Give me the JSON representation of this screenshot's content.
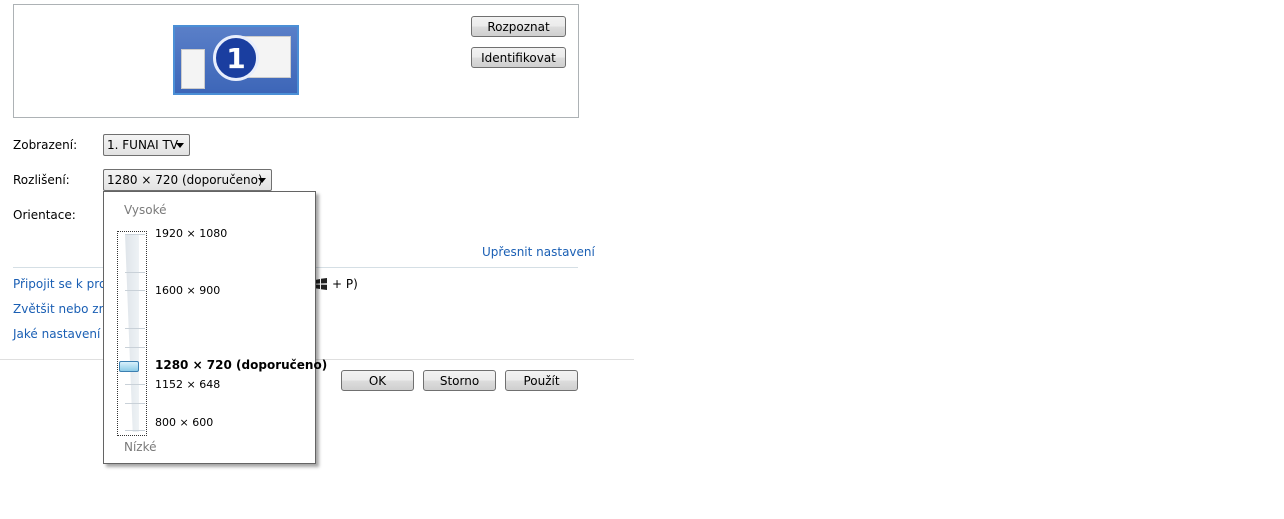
{
  "buttons": {
    "detect": "Rozpoznat",
    "identify": "Identifikovat",
    "ok": "OK",
    "cancel": "Storno",
    "apply": "Použít"
  },
  "preview": {
    "monitor_number": "1"
  },
  "fields": {
    "display_label": "Zobrazení:",
    "display_value": "1. FUNAI TV",
    "resolution_label": "Rozlišení:",
    "resolution_value": "1280 × 720 (doporučeno)",
    "orientation_label": "Orientace:"
  },
  "links": {
    "advanced": "Upřesnit nastavení",
    "projector": "Připojit se k proje",
    "projector_shortcut": "+ P)",
    "resize": "Zvětšit nebo zme",
    "which_settings": "Jaké nastavení m"
  },
  "resolution_popup": {
    "high_label": "Vysoké",
    "low_label": "Nízké",
    "items": [
      "1920 × 1080",
      "1600 × 900",
      "1280 × 720 (doporučeno)",
      "1152 × 648",
      "800 × 600"
    ],
    "selected": "1280 × 720 (doporučeno)"
  }
}
